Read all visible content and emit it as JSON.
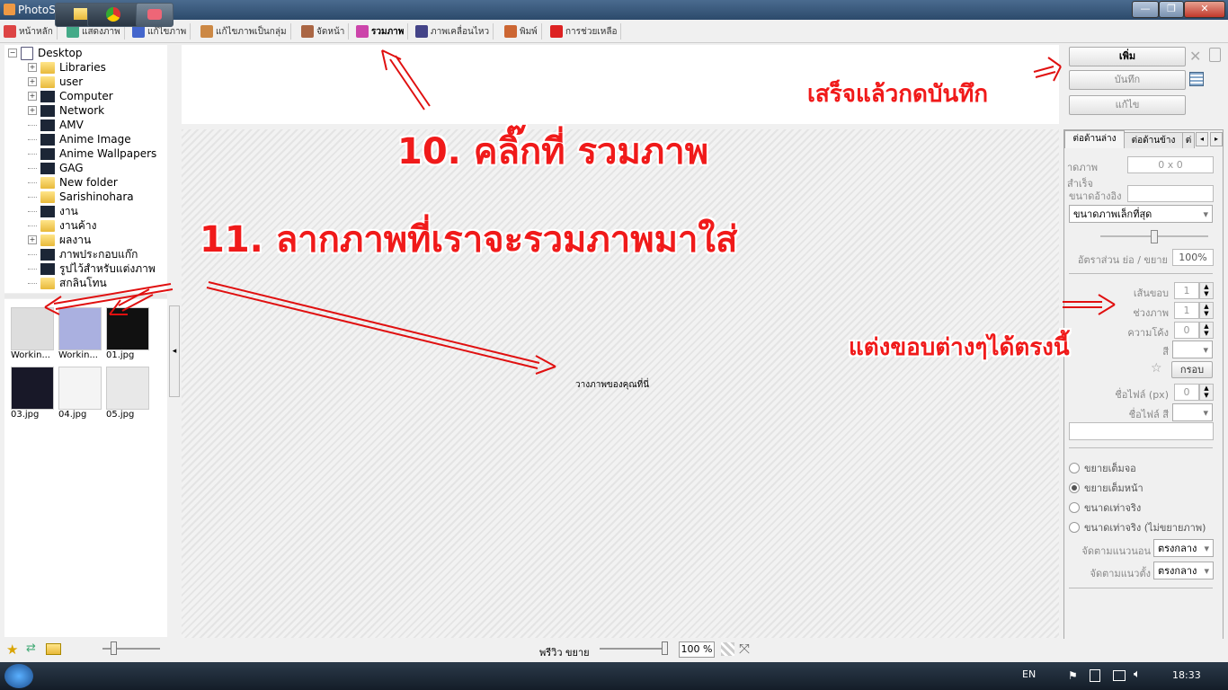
{
  "window": {
    "title": "PhotoScape",
    "min": "—",
    "max": "❐",
    "close": "✕"
  },
  "menu": [
    {
      "label": "หน้าหลัก",
      "color": "#d44"
    },
    {
      "label": "แสดงภาพ",
      "color": "#4a8"
    },
    {
      "label": "แก้ไขภาพ",
      "color": "#46c"
    },
    {
      "label": "แก้ไขภาพเป็นกลุ่ม",
      "color": "#c84"
    },
    {
      "label": "จัดหน้า",
      "color": "#a64"
    },
    {
      "label": "รวมภาพ",
      "color": "#c4a"
    },
    {
      "label": "ภาพเคลื่อนไหว",
      "color": "#448"
    },
    {
      "label": "พิมพ์",
      "color": "#c63"
    },
    {
      "label": "การช่วยเหลือ",
      "color": "#d22"
    }
  ],
  "tree": [
    {
      "label": "Desktop",
      "exp": "−",
      "type": "desk"
    },
    {
      "label": "Libraries",
      "exp": "+",
      "type": "folder"
    },
    {
      "label": "user",
      "exp": "+",
      "type": "folder"
    },
    {
      "label": "Computer",
      "exp": "+",
      "type": "dark"
    },
    {
      "label": "Network",
      "exp": "+",
      "type": "dark"
    },
    {
      "label": "AMV",
      "exp": "",
      "type": "dark"
    },
    {
      "label": "Anime Image",
      "exp": "",
      "type": "dark"
    },
    {
      "label": "Anime Wallpapers",
      "exp": "",
      "type": "dark"
    },
    {
      "label": "GAG",
      "exp": "",
      "type": "dark"
    },
    {
      "label": "New folder",
      "exp": "",
      "type": "folder"
    },
    {
      "label": "Sarishinohara",
      "exp": "",
      "type": "folder"
    },
    {
      "label": "งาน",
      "exp": "",
      "type": "dark"
    },
    {
      "label": "งานค้าง",
      "exp": "",
      "type": "folder"
    },
    {
      "label": "ผลงาน",
      "exp": "+",
      "type": "folder"
    },
    {
      "label": "ภาพประกอบแก๊ก",
      "exp": "",
      "type": "dark"
    },
    {
      "label": "รูปไว้สำหรับแต่งภาพ",
      "exp": "",
      "type": "dark"
    },
    {
      "label": "สกลินโทน",
      "exp": "",
      "type": "folder"
    }
  ],
  "thumbs": [
    {
      "label": "Workin...",
      "bg": "#ddd"
    },
    {
      "label": "Workin...",
      "bg": "#aab0e0"
    },
    {
      "label": "01.jpg",
      "bg": "#111"
    },
    {
      "label": "03.jpg",
      "bg": "#181828"
    },
    {
      "label": "04.jpg",
      "bg": "#f4f4f4"
    },
    {
      "label": "05.jpg",
      "bg": "#e8e8e8"
    }
  ],
  "center": {
    "drop_text": "วางภาพของคุณที่นี่"
  },
  "right": {
    "add_button": "เพิ่ม",
    "save_button": "บันทึก",
    "edit_button": "แก้ไข",
    "tabs": [
      "ต่อด้านล่าง",
      "ต่อด้านข้าง",
      "ต่"
    ],
    "final_size_label": "าดภาพสำเร็จ",
    "final_size_value": "0 x 0",
    "ref_size_label": "ขนาดอ้างอิง",
    "size_mode": "ขนาดภาพเล็กที่สุด",
    "ratio_label": "อัตราส่วน ย่อ / ขยาย",
    "ratio_value": "100%",
    "border_label": "เส้นขอบ",
    "border_value": "1",
    "gap_label": "ช่วงภาพ",
    "gap_value": "1",
    "curve_label": "ความโค้ง",
    "curve_value": "0",
    "color_label": "สี",
    "frame_button": "กรอบ",
    "fillet_px_label": "ชื่อไฟล์ (px)",
    "fillet_px_value": "0",
    "fillet_color_label": "ชื่อไฟล์ สี",
    "radios": [
      "ขยายเต็มจอ",
      "ขยายเต็มหน้า",
      "ขนาดเท่าจริง",
      "ขนาดเท่าจริง (ไม่ขยายภาพ)"
    ],
    "selected_radio": 1,
    "halign_label": "จัดตามแนวนอน",
    "halign_value": "ตรงกลาง",
    "valign_label": "จัดตามแนวตั้ง",
    "valign_value": "ตรงกลาง"
  },
  "bottom": {
    "preview_label": "พรีวิว ขยาย",
    "zoom": "100 %"
  },
  "taskbar": {
    "lang": "EN",
    "time": "18:33"
  },
  "annotations": {
    "step10": "10. คลิ๊กที่ รวมภาพ",
    "step11": "11. ลากภาพที่เราจะรวมภาพมาใส่",
    "save_note": "เสร็จแล้วกดบันทึก",
    "border_note": "แต่งขอบต่างๆได้ตรงนี้"
  }
}
